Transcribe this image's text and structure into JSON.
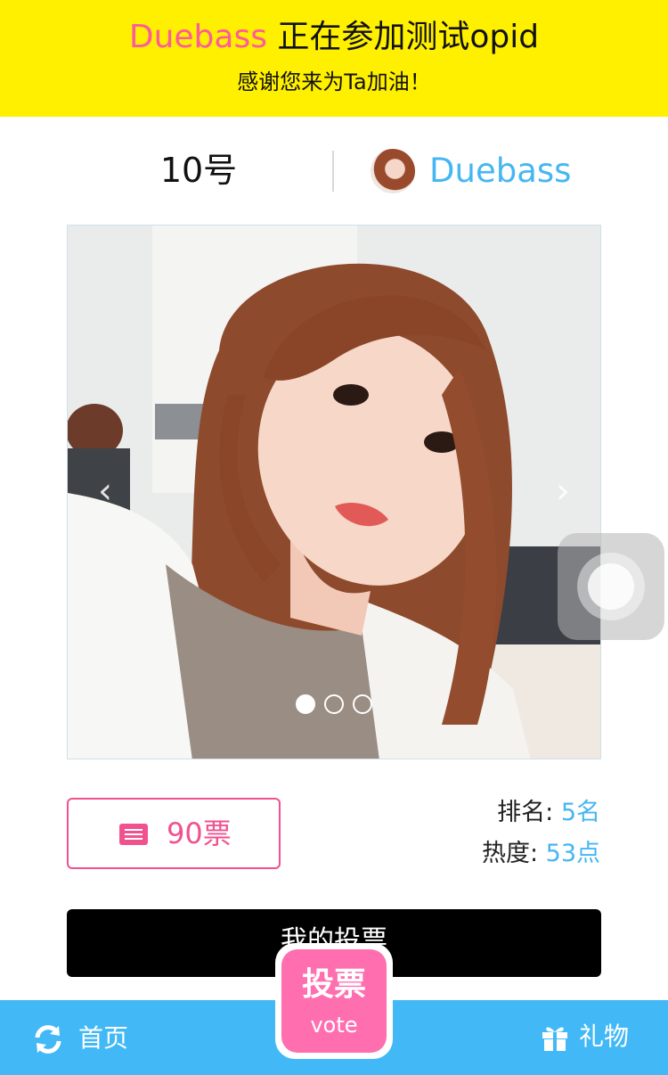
{
  "banner": {
    "name": "Duebass",
    "title_rest": " 正在参加测试opid",
    "subtitle": "感谢您来为Ta加油！"
  },
  "contestant": {
    "number": "10号",
    "name": "Duebass"
  },
  "carousel": {
    "slide_count": 3,
    "active_index": 0
  },
  "stats": {
    "votes": "90票",
    "rank_label": "排名: ",
    "rank_value": "5名",
    "heat_label": "热度: ",
    "heat_value": "53点"
  },
  "actions": {
    "my_votes": "我的投票",
    "vote_label": "投票",
    "vote_sub": "vote"
  },
  "tabbar": {
    "home": "首页",
    "gift": "礼物"
  },
  "colors": {
    "banner_bg": "#fff000",
    "accent_pink": "#f0528f",
    "accent_blue": "#46b6f2",
    "tabbar_bg": "#42b9f6"
  }
}
